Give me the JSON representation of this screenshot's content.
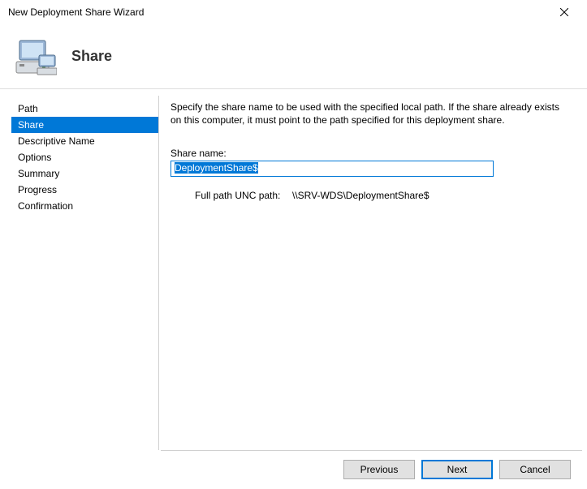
{
  "window": {
    "title": "New Deployment Share Wizard"
  },
  "header": {
    "title": "Share"
  },
  "sidebar": {
    "items": [
      {
        "label": "Path",
        "selected": false
      },
      {
        "label": "Share",
        "selected": true
      },
      {
        "label": "Descriptive Name",
        "selected": false
      },
      {
        "label": "Options",
        "selected": false
      },
      {
        "label": "Summary",
        "selected": false
      },
      {
        "label": "Progress",
        "selected": false
      },
      {
        "label": "Confirmation",
        "selected": false
      }
    ]
  },
  "content": {
    "instructions": "Specify the share name to be used with the specified local path.  If the share already exists on this computer, it must point to the path specified for this deployment share.",
    "share_name_label": "Share name:",
    "share_name_value": "DeploymentShare$",
    "unc_label": "Full path UNC path:",
    "unc_value": "\\\\SRV-WDS\\DeploymentShare$"
  },
  "footer": {
    "previous": "Previous",
    "next": "Next",
    "cancel": "Cancel"
  }
}
